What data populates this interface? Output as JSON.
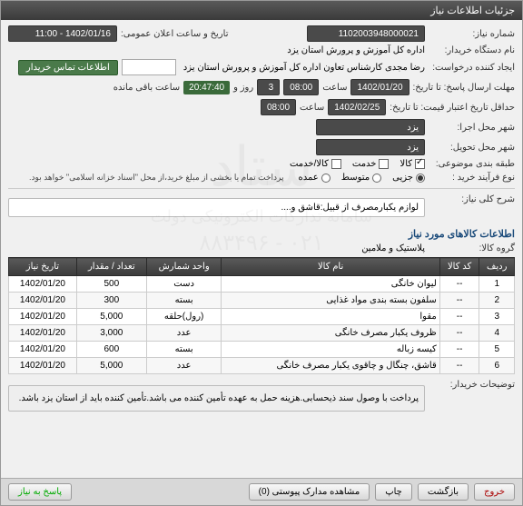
{
  "title": "جزئیات اطلاعات نیاز",
  "labels": {
    "need_no": "شماره نیاز:",
    "announce": "تاریخ و ساعت اعلان عمومی:",
    "buyer": "نام دستگاه خریدار:",
    "requester": "ایجاد کننده درخواست:",
    "contact_btn": "اطلاعات تماس خریدار",
    "deadline": "مهلت ارسال پاسخ: تا تاریخ:",
    "time": "ساعت",
    "remaining": "ساعت باقی مانده",
    "validity": "حداقل تاریخ اعتبار قیمت: تا تاریخ:",
    "exec_city": "شهر محل اجرا:",
    "deliv_city": "شهر محل تحویل:",
    "category": "طبقه بندی موضوعی:",
    "process": "نوع فرآیند خرید :",
    "payment_note": "پرداخت تمام یا بخشی از مبلغ خرید،از محل \"اسناد خزانه اسلامی\" خواهد بود.",
    "general_desc": "شرح کلی نیاز:",
    "items_section": "اطلاعات کالاهای مورد نیاز",
    "group": "گروه کالا:",
    "buyer_notes_lbl": "توضیحات خریدار:"
  },
  "values": {
    "need_no": "1102003948000021",
    "announce": "1402/01/16 - 11:00",
    "buyer": "اداره کل آموزش و پرورش استان یزد",
    "requester": "رضا مجدی کارشناس تعاون اداره کل آموزش و پرورش استان یزد",
    "deadline_date": "1402/01/20",
    "deadline_time": "08:00",
    "days_left": "3",
    "countdown": "20:47:40",
    "validity_date": "1402/02/25",
    "validity_time": "08:00",
    "exec_city": "یزد",
    "deliv_city": "یزد",
    "general_desc": "لوازم یکبارمصرف از قبیل:قاشق و....",
    "group": "پلاستیک و ملامین",
    "buyer_notes": "پرداخت با وصول سند ذیحسابی.هزینه حمل به عهده تأمین کننده می باشد.تأمین کننده باید از استان یزد باشد."
  },
  "category_opts": {
    "goods": "کالا",
    "service": "خدمت",
    "both": "کالا/خدمت"
  },
  "process_opts": {
    "small": "جزیی",
    "medium": "متوسط",
    "large": "عمده"
  },
  "table": {
    "headers": {
      "row": "ردیف",
      "code": "کد کالا",
      "name": "نام کالا",
      "unit": "واحد شمارش",
      "qty": "تعداد / مقدار",
      "date": "تاریخ نیاز"
    },
    "rows": [
      {
        "r": "1",
        "code": "--",
        "name": "لیوان خانگی",
        "unit": "دست",
        "qty": "500",
        "date": "1402/01/20"
      },
      {
        "r": "2",
        "code": "--",
        "name": "سلفون بسته بندی مواد غذایی",
        "unit": "بسته",
        "qty": "300",
        "date": "1402/01/20"
      },
      {
        "r": "3",
        "code": "--",
        "name": "مقوا",
        "unit": "(رول)حلقه",
        "qty": "5,000",
        "date": "1402/01/20"
      },
      {
        "r": "4",
        "code": "--",
        "name": "ظروف یکبار مصرف خانگی",
        "unit": "عدد",
        "qty": "3,000",
        "date": "1402/01/20"
      },
      {
        "r": "5",
        "code": "--",
        "name": "کیسه زباله",
        "unit": "بسته",
        "qty": "600",
        "date": "1402/01/20"
      },
      {
        "r": "6",
        "code": "--",
        "name": "قاشق، چنگال و چاقوی یکبار مصرف خانگی",
        "unit": "عدد",
        "qty": "5,000",
        "date": "1402/01/20"
      }
    ]
  },
  "footer": {
    "reply": "پاسخ به نیاز",
    "attach": "مشاهده مدارک پیوستی (0)",
    "print": "چاپ",
    "back": "بازگشت",
    "exit": "خروج"
  },
  "watermark": "ستاد\nسامانه تدارکات الکترونیکی دولت\n۰۲۱ - ۸۸۳۴۹۶"
}
